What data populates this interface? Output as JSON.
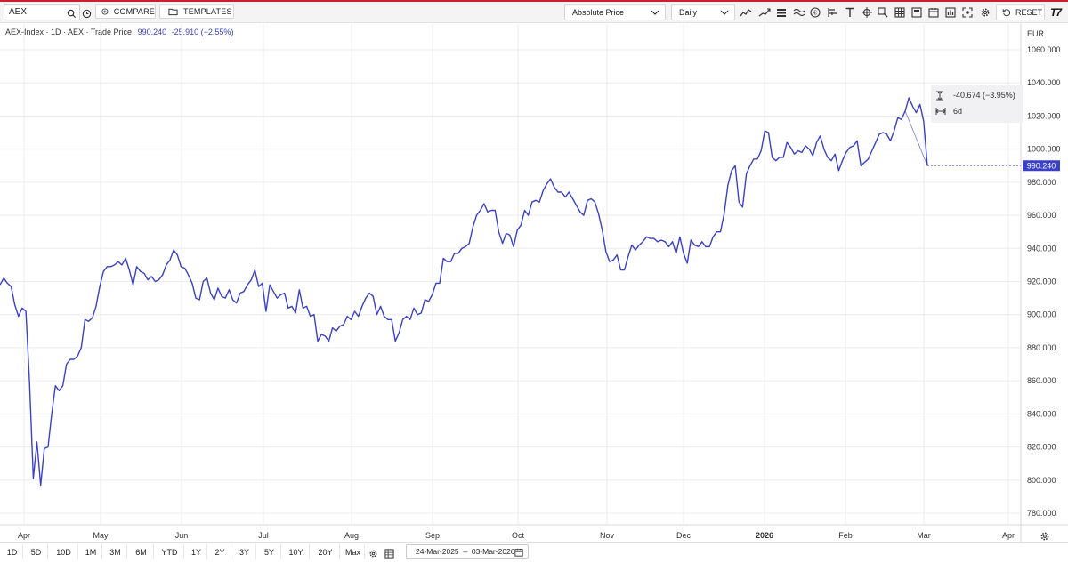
{
  "toolbar": {
    "search_value": "AEX",
    "compare_label": "COMPARE",
    "templates_label": "TEMPLATES",
    "price_mode": "Absolute Price",
    "interval": "Daily",
    "reset_label": "RESET",
    "logo_text": "T7",
    "icons": [
      "line-chart-icon",
      "trend-icon",
      "bar-style-icon",
      "wave-icon",
      "euro-icon",
      "indicator-icon",
      "text-icon",
      "crosshair-icon",
      "zoom-icon",
      "table-icon",
      "grid-icon",
      "calendar-icon",
      "stats-icon",
      "screenshot-icon",
      "settings-icon"
    ]
  },
  "legend": {
    "instrument": "AEX-Index · 1D · AEX · Trade Price",
    "last": "990.240",
    "change": "-25.910 (−2.55%)"
  },
  "tooltip": {
    "delta": "-40.674 (−3.95%)",
    "span": "6d"
  },
  "currency": "EUR",
  "price_label": "990.240",
  "colors": {
    "line": "#3a41c6",
    "accent": "#cc1f2d",
    "grid": "#ececef"
  },
  "ranges": [
    "1D",
    "5D",
    "10D",
    "1M",
    "3M",
    "6M",
    "YTD",
    "1Y",
    "2Y",
    "3Y",
    "5Y",
    "10Y",
    "20Y",
    "Max"
  ],
  "date_range": "24-Mar-2025  –  03-Mar-2026",
  "chart_data": {
    "type": "line",
    "title": "",
    "ylabel": "EUR",
    "ylim": [
      770,
      1070
    ],
    "y_ticks": [
      "1060.000",
      "1040.000",
      "1020.000",
      "1000.000",
      "980.000",
      "960.000",
      "940.000",
      "920.000",
      "900.000",
      "880.000",
      "860.000",
      "840.000",
      "820.000",
      "800.000",
      "780.000"
    ],
    "x_ticks": [
      "Apr",
      "May",
      "Jun",
      "Jul",
      "Aug",
      "Sep",
      "Oct",
      "Nov",
      "Dec",
      "2026",
      "Feb",
      "Mar",
      "Apr"
    ],
    "series": [
      {
        "values": [
          918,
          922,
          919,
          917,
          906,
          899,
          904,
          902,
          859,
          801,
          823,
          797,
          819,
          820,
          840,
          857,
          854,
          857,
          870,
          873,
          873,
          875,
          880,
          897,
          896,
          898,
          905,
          917,
          926,
          929,
          929,
          930,
          932,
          930,
          934,
          927,
          918,
          929,
          926,
          925,
          921,
          923,
          920,
          921,
          924,
          930,
          933,
          939,
          936,
          929,
          928,
          924,
          919,
          910,
          909,
          920,
          922,
          913,
          909,
          916,
          911,
          910,
          915,
          909,
          907,
          913,
          914,
          918,
          921,
          927,
          917,
          919,
          902,
          918,
          914,
          910,
          912,
          913,
          904,
          905,
          901,
          915,
          904,
          905,
          899,
          900,
          884,
          888,
          887,
          884,
          892,
          890,
          893,
          894,
          899,
          897,
          902,
          899,
          905,
          910,
          913,
          911,
          900,
          905,
          899,
          897,
          897,
          884,
          889,
          897,
          899,
          897,
          904,
          900,
          901,
          909,
          908,
          912,
          919,
          919,
          934,
          932,
          932,
          937,
          937,
          940,
          941,
          943,
          953,
          960,
          963,
          967,
          962,
          963,
          963,
          950,
          943,
          949,
          948,
          941,
          951,
          954,
          963,
          960,
          968,
          969,
          968,
          975,
          979,
          982,
          977,
          974,
          974,
          971,
          974,
          970,
          966,
          962,
          960,
          969,
          970,
          968,
          961,
          951,
          938,
          932,
          933,
          936,
          927,
          927,
          935,
          942,
          939,
          942,
          944,
          947,
          946,
          946,
          944,
          945,
          944,
          941,
          944,
          937,
          947,
          937,
          931,
          945,
          942,
          941,
          944,
          941,
          941,
          947,
          950,
          950,
          961,
          978,
          987,
          990,
          968,
          965,
          985,
          990,
          994,
          994,
          999,
          1011,
          1010,
          995,
          993,
          995,
          995,
          1004,
          1001,
          997,
          999,
          998,
          1002,
          1000,
          996,
          1004,
          1008,
          1000,
          995,
          993,
          997,
          987,
          993,
          998,
          1001,
          1002,
          1005,
          990,
          992,
          994,
          999,
          1004,
          1009,
          1010,
          1009,
          1005,
          1011,
          1019,
          1018,
          1023,
          1031,
          1026,
          1022,
          1027,
          1017,
          990
        ],
        "start_date": "2025-03-24",
        "end_date": "2026-03-03"
      }
    ]
  }
}
